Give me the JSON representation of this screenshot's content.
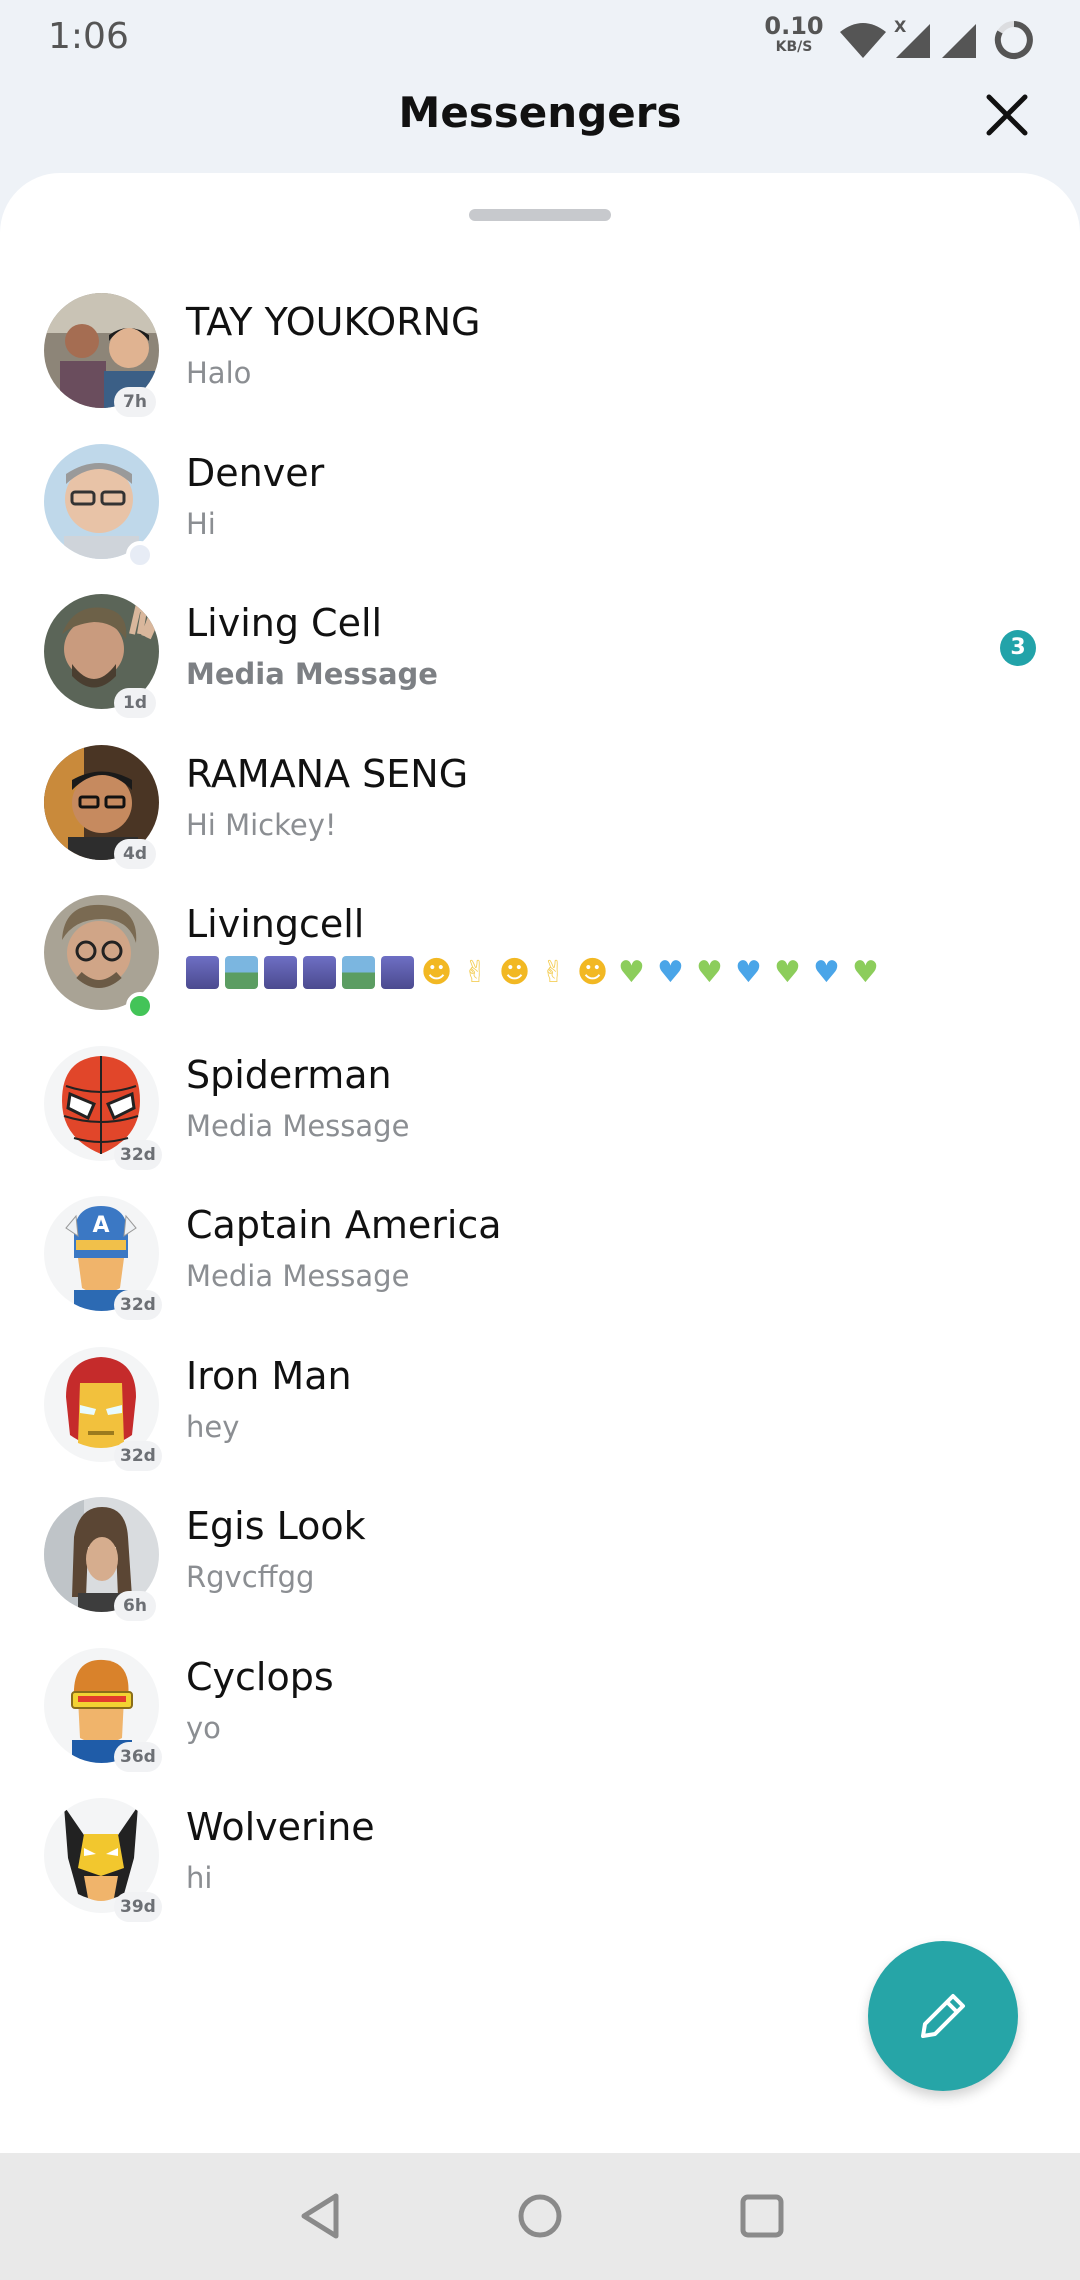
{
  "status_bar": {
    "time": "1:06",
    "net_speed_value": "0.10",
    "net_speed_unit": "KB/S",
    "wifi_badge": "X",
    "icons": [
      "wifi-icon",
      "signal-icon",
      "signal-icon",
      "battery-ring-icon"
    ]
  },
  "header": {
    "title": "Messengers",
    "close_icon": "close-icon"
  },
  "colors": {
    "accent": "#26a5a7",
    "unread_badge": "#22a3a9",
    "online": "#43c458"
  },
  "conversations": [
    {
      "name": "TAY YOUKORNG",
      "preview": "Halo",
      "time": "7h"
    },
    {
      "name": "Denver",
      "preview": "Hi",
      "status": "away"
    },
    {
      "name": "Living Cell",
      "preview": "Media Message",
      "time": "1d",
      "unread": "3",
      "preview_bold": true
    },
    {
      "name": "RAMANA SENG",
      "preview": "Hi Mickey!",
      "time": "4d"
    },
    {
      "name": "Livingcell",
      "preview_emoji": [
        "night-tile",
        "mountain-tile",
        "night-tile",
        "night-tile",
        "mountain-tile",
        "night-tile",
        "grin",
        "peace",
        "grin",
        "peace",
        "grin",
        "green-heart",
        "blue-heart",
        "green-heart",
        "blue-heart",
        "green-heart",
        "blue-heart",
        "green-heart"
      ],
      "status": "online"
    },
    {
      "name": "Spiderman",
      "preview": "Media Message",
      "time": "32d"
    },
    {
      "name": "Captain America",
      "preview": "Media Message",
      "time": "32d"
    },
    {
      "name": "Iron Man",
      "preview": "hey",
      "time": "32d"
    },
    {
      "name": "Egis Look",
      "preview": "Rgvcffgg",
      "time": "6h"
    },
    {
      "name": "Cyclops",
      "preview": "yo",
      "time": "36d"
    },
    {
      "name": "Wolverine",
      "preview": "hi",
      "time": "39d"
    }
  ],
  "compose_icon": "pencil-icon",
  "nav_bar": {
    "icons": [
      "back-icon",
      "home-icon",
      "recents-icon"
    ]
  }
}
